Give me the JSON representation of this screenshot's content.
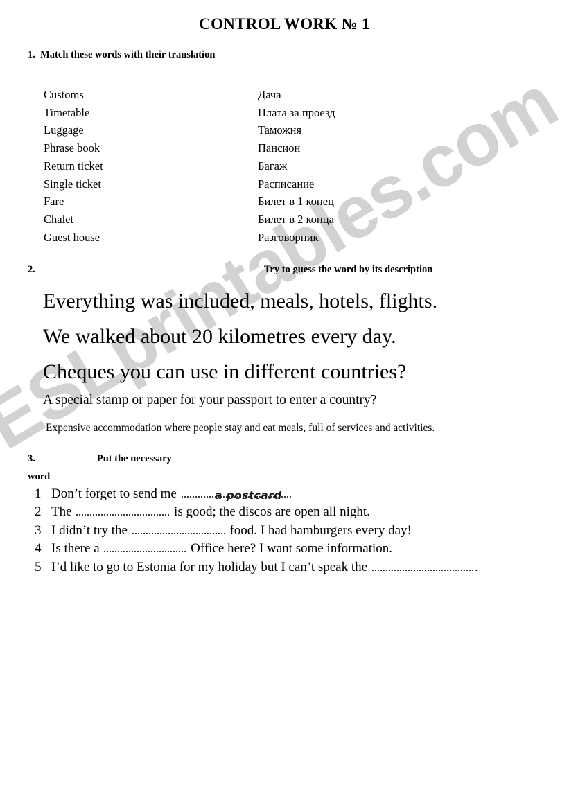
{
  "document": {
    "title": "CONTROL WORK № 1",
    "watermark": "ESLprintables.com",
    "watermark_color": "#d2d2d2"
  },
  "section1": {
    "number": "1.",
    "heading": "Match these words with their translation",
    "english_words": [
      "Customs",
      "Timetable",
      "Luggage",
      "Phrase book",
      "Return ticket",
      "Single ticket",
      "Fare",
      "Chalet",
      "Guest house"
    ],
    "russian_words": [
      "Дача",
      "Плата за проезд",
      "Таможня",
      "Пансион",
      "Багаж",
      "Расписание",
      "Билет в 1 конец",
      "Билет в 2 конца",
      "Разговорник"
    ]
  },
  "section2": {
    "number": "2.",
    "heading": "Try to guess the word by its description",
    "descriptions": [
      "Everything was included, meals, hotels, flights.",
      "We walked about 20 kilometres every day.",
      "Cheques you can use in different countries?",
      "A special stamp or paper for your passport to enter a country?",
      "Expensive accommodation where people stay and eat meals, full of services and activities."
    ]
  },
  "section3": {
    "number": "3.",
    "heading_line1": "Put the necessary",
    "heading_line2": "word",
    "items": [
      {
        "index": "1",
        "before": "Don’t forget to send me",
        "after": "",
        "answer": "a postcard"
      },
      {
        "index": "2",
        "before": "The",
        "after": "is good; the discos are open all night.",
        "answer": ""
      },
      {
        "index": "3",
        "before": "I didn’t try the",
        "after": "food. I had hamburgers every day!",
        "answer": ""
      },
      {
        "index": "4",
        "before": "Is there a",
        "after": "Office here?  I want some information.",
        "answer": ""
      },
      {
        "index": "5",
        "before": "I’d like to go to Estonia for my holiday but I can’t speak the",
        "after": ".",
        "answer": ""
      }
    ]
  }
}
